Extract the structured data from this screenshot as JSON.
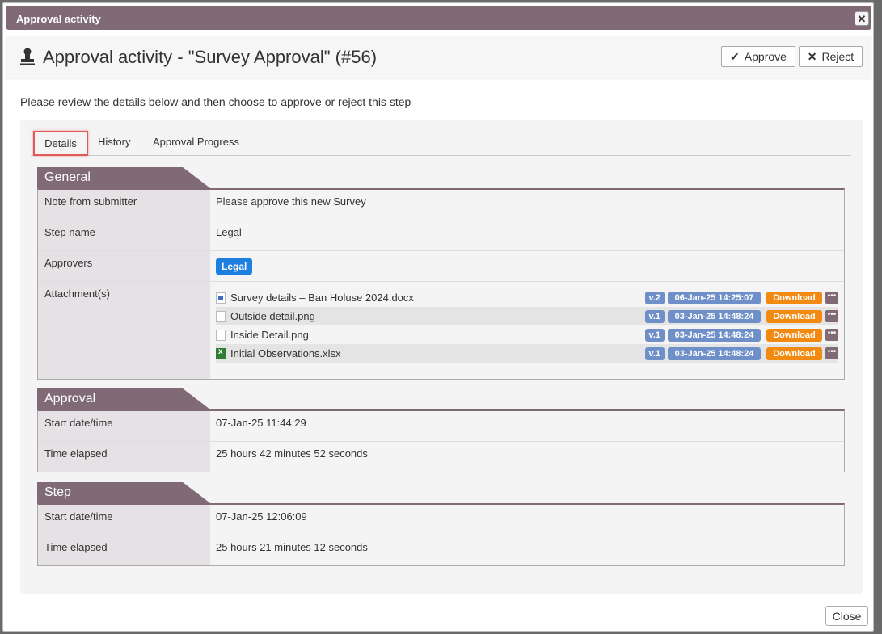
{
  "window": {
    "title": "Approval activity",
    "close_glyph": "✕"
  },
  "header": {
    "heading": "Approval activity - \"Survey Approval\" (#56)",
    "icon": "stamp-icon",
    "approve_label": "Approve",
    "reject_label": "Reject"
  },
  "intro": "Please review the details below and then choose to approve or reject this step",
  "tabs": [
    {
      "label": "Details",
      "active": true
    },
    {
      "label": "History",
      "active": false
    },
    {
      "label": "Approval Progress",
      "active": false
    }
  ],
  "general": {
    "title": "General",
    "note_label": "Note from submitter",
    "note_value": "Please approve this new Survey",
    "step_label": "Step name",
    "step_value": "Legal",
    "approvers_label": "Approvers",
    "approvers_badge": "Legal",
    "attachments_label": "Attachment(s)",
    "attachments": [
      {
        "name": "Survey details – Ban Holuse 2024.docx",
        "icon": "word-doc-icon",
        "version": "v.2",
        "date": "06-Jan-25 14:25:07",
        "download": "Download",
        "more": "•••"
      },
      {
        "name": "Outside detail.png",
        "icon": "file-icon",
        "version": "v.1",
        "date": "03-Jan-25 14:48:24",
        "download": "Download",
        "more": "•••"
      },
      {
        "name": "Inside Detail.png",
        "icon": "file-icon",
        "version": "v.1",
        "date": "03-Jan-25 14:48:24",
        "download": "Download",
        "more": "•••"
      },
      {
        "name": "Initial Observations.xlsx",
        "icon": "excel-icon",
        "version": "v.1",
        "date": "03-Jan-25 14:48:24",
        "download": "Download",
        "more": "•••"
      }
    ]
  },
  "approval": {
    "title": "Approval",
    "start_label": "Start date/time",
    "start_value": "07-Jan-25 11:44:29",
    "elapsed_label": "Time elapsed",
    "elapsed_value": "25 hours 42 minutes 52 seconds"
  },
  "step": {
    "title": "Step",
    "start_label": "Start date/time",
    "start_value": "07-Jan-25 12:06:09",
    "elapsed_label": "Time elapsed",
    "elapsed_value": "25 hours 21 minutes 12 seconds"
  },
  "footer": {
    "close_label": "Close"
  },
  "colors": {
    "accent": "#806a75",
    "download": "#f28a12",
    "badge": "#1d7fe0",
    "version": "#6e8fc8"
  }
}
